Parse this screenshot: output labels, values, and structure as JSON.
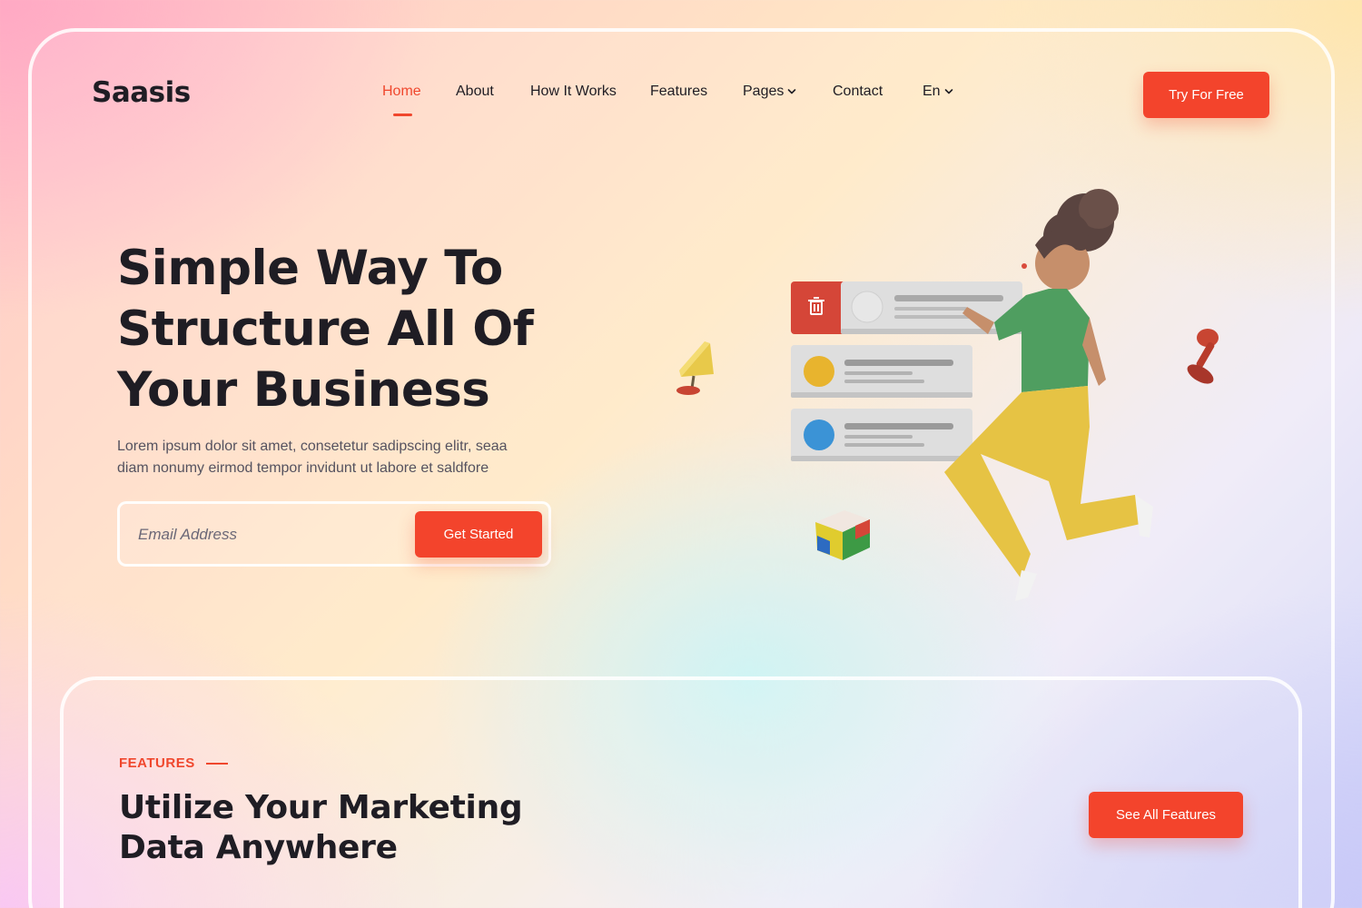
{
  "header": {
    "logo": "Saasis",
    "nav": [
      {
        "label": "Home",
        "active": true
      },
      {
        "label": "About"
      },
      {
        "label": "How It Works"
      },
      {
        "label": "Features"
      },
      {
        "label": "Pages",
        "has_dropdown": true
      },
      {
        "label": "Contact"
      },
      {
        "label": "En",
        "has_dropdown": true
      }
    ],
    "cta_label": "Try For Free"
  },
  "hero": {
    "title_lines": [
      "Simple Way To",
      "Structure All Of",
      "Your Business"
    ],
    "description_lines": [
      "Lorem ipsum dolor sit amet, consetetur sadipscing elitr, seaa",
      "diam nonumy eirmod tempor invidunt ut labore et saldfore"
    ],
    "email_placeholder": "Email Address",
    "submit_label": "Get Started"
  },
  "features": {
    "tag": "FEATURES",
    "title_lines": [
      "Utilize Your Marketing",
      "Data Anywhere"
    ],
    "button_label": "See All Features"
  },
  "colors": {
    "accent": "#f3442c",
    "text_dark": "#1f1d24",
    "text_muted": "#55525f"
  },
  "icons": {
    "nav_dropdown": "chevron-down-icon",
    "trash": "trash-icon"
  }
}
